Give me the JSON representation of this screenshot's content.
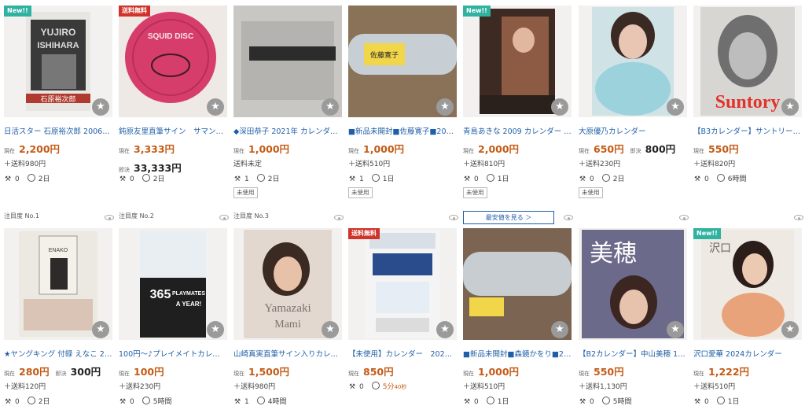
{
  "labels": {
    "current": "現在",
    "buy_now": "即決",
    "unused": "未使用",
    "lowest_price_button": "最安値を見る ＞",
    "new_tag": "New!!",
    "free_ship_tag": "送料無料"
  },
  "row1": [
    {
      "tag": "New!!",
      "title": "日活スター 石原裕次郎 2006年…",
      "price": "2,200円",
      "ship": "＋送料980円",
      "bids": "0",
      "time": "2日",
      "unused": false,
      "rank": "注目度 No.1",
      "lowest": false
    },
    {
      "tag": "送料無料",
      "title": "鈍原友里直筆サイン　サマンサ…",
      "price": "3,333円",
      "buy_now_price": "33,333円",
      "ship": "",
      "bids": "0",
      "time": "2日",
      "unused": false,
      "rank": "注目度 No.2",
      "lowest": false
    },
    {
      "tag": "",
      "title": "◆深田恭子 2021年 カレンダー…",
      "price": "1,000円",
      "ship": "送料未定",
      "bids": "1",
      "time": "2日",
      "unused": true,
      "rank": "注目度 No.3",
      "lowest": false
    },
    {
      "tag": "",
      "title": "■新品未開封■佐藤寛子■2008…",
      "price": "1,000円",
      "ship": "＋送料510円",
      "bids": "1",
      "time": "1日",
      "unused": true,
      "rank": "",
      "lowest": false
    },
    {
      "tag": "New!!",
      "title": "青島あきな 2009 カレンダー サ…",
      "price": "2,000円",
      "ship": "＋送料810円",
      "bids": "0",
      "time": "1日",
      "unused": true,
      "rank": "",
      "lowest": true
    },
    {
      "tag": "",
      "title": "大原優乃カレンダー",
      "price": "650円",
      "buy_now_price": "800円",
      "ship": "＋送料230円",
      "bids": "0",
      "time": "2日",
      "unused": true,
      "rank": "",
      "lowest": false
    },
    {
      "tag": "",
      "title": "【B3カレンダー】サントリー 19…",
      "price": "550円",
      "ship": "＋送料820円",
      "bids": "0",
      "time": "6時間",
      "unused": false,
      "rank": "",
      "lowest": false
    }
  ],
  "row2": [
    {
      "tag": "",
      "title": "★ヤングキング 付録 えなこ 202…",
      "price": "280円",
      "buy_now_price": "300円",
      "ship": "＋送料120円",
      "bids": "0",
      "time": "2日"
    },
    {
      "tag": "",
      "title": "100円〜♪プレイメイトカレンダ…",
      "price": "100円",
      "ship": "＋送料230円",
      "bids": "0",
      "time": "5時間"
    },
    {
      "tag": "",
      "title": "山崎真実直筆サイン入りカレン…",
      "price": "1,500円",
      "ship": "＋送料980円",
      "bids": "1",
      "time": "4時間"
    },
    {
      "tag": "送料無料",
      "title": "【未使用】カレンダー　2024年…",
      "price": "850円",
      "ship": "",
      "bids": "0",
      "time": "5分",
      "time_sub": "40秒"
    },
    {
      "tag": "",
      "title": "■新品未開封■森鏡かをり■200…",
      "price": "1,000円",
      "ship": "＋送料510円",
      "bids": "0",
      "time": "1日"
    },
    {
      "tag": "",
      "title": "【B2カレンダー】中山美穂 198…",
      "price": "550円",
      "ship": "＋送料1,130円",
      "bids": "0",
      "time": "5時間"
    },
    {
      "tag": "New!!",
      "title": "沢口愛華 2024カレンダー",
      "price": "1,222円",
      "ship": "＋送料510円",
      "bids": "0",
      "time": "1日"
    }
  ],
  "thumb_text": {
    "yujiro": "YUJIRO ISHIHARA",
    "yujiro_jp": "石原裕次郎",
    "squid": "SQUID DISC",
    "suntory": "Suntory",
    "playmates": "365 PLAYMATES A YEAR!",
    "yamazaki": "Yamazaki Mami",
    "miho": "美穂",
    "enako": "ENAKO",
    "sawaguchi": "沢口"
  },
  "colors": {
    "price": "#c45b16",
    "title_link": "#1f5fa8",
    "new_tag": "#2fb2a0",
    "free_tag": "#d0332a"
  }
}
